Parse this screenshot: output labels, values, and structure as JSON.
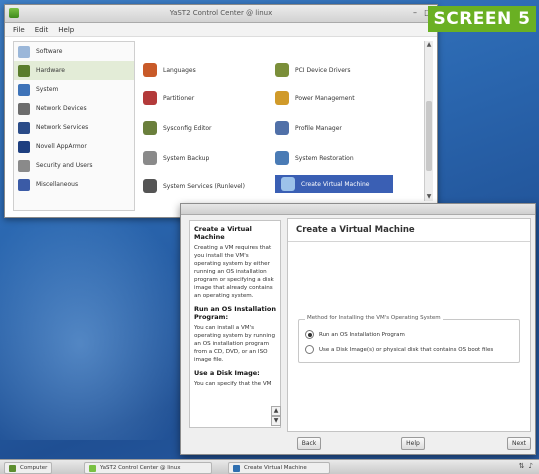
{
  "badge": "SCREEN 5",
  "yast": {
    "title": "YaST2 Control Center @ linux",
    "menu": [
      "File",
      "Edit",
      "Help"
    ],
    "win_controls": [
      "–",
      "□"
    ],
    "categories": [
      {
        "label": "Software",
        "color": "#9bb7d9"
      },
      {
        "label": "Hardware",
        "color": "#5a7d2c"
      },
      {
        "label": "System",
        "color": "#3e73b8"
      },
      {
        "label": "Network Devices",
        "color": "#6c6c6c"
      },
      {
        "label": "Network Services",
        "color": "#2a4b88"
      },
      {
        "label": "Novell AppArmor",
        "color": "#1e3f80"
      },
      {
        "label": "Security and Users",
        "color": "#8a8a8a"
      },
      {
        "label": "Miscellaneous",
        "color": "#3b5ba6"
      }
    ],
    "modules": [
      {
        "label": "Languages",
        "color": "#c85a28"
      },
      {
        "label": "PCI Device Drivers",
        "color": "#7b8f3a"
      },
      {
        "label": "Partitioner",
        "color": "#b33a3a"
      },
      {
        "label": "Power Management",
        "color": "#d09a2a"
      },
      {
        "label": "Sysconfig Editor",
        "color": "#6a7f3c"
      },
      {
        "label": "Profile Manager",
        "color": "#5070a8"
      },
      {
        "label": "System Backup",
        "color": "#8a8a8a"
      },
      {
        "label": "System Restoration",
        "color": "#4a7bb5"
      },
      {
        "label": "System Services (Runlevel)",
        "color": "#555555"
      },
      {
        "label": "Create Virtual Machine",
        "color": "#2f6fb0"
      }
    ]
  },
  "vm": {
    "main_title": "Create a Virtual Machine",
    "help": {
      "heading": "Create a Virtual Machine",
      "para1": "Creating a VM requires that you install the VM's operating system by either running an OS installation program or specifying a disk image that already contains an operating system.",
      "heading2": "Run an OS Installation Program:",
      "para2": "You can install a VM's operating system by running an OS installation program from a CD, DVD, or an ISO image file.",
      "heading3": "Use a Disk Image:",
      "para3": "You can specify that the VM"
    },
    "group_label": "Method for Installing the VM's Operating System",
    "option1": "Run an OS Installation Program",
    "option2": "Use a Disk Image(s) or physical disk that contains OS boot files",
    "selected_option": 1,
    "buttons": {
      "back": "Back",
      "help": "Help",
      "next": "Next"
    }
  },
  "taskbar": {
    "items": [
      "Computer",
      "YaST2 Control Center @ linux",
      "Create Virtual Machine"
    ]
  }
}
